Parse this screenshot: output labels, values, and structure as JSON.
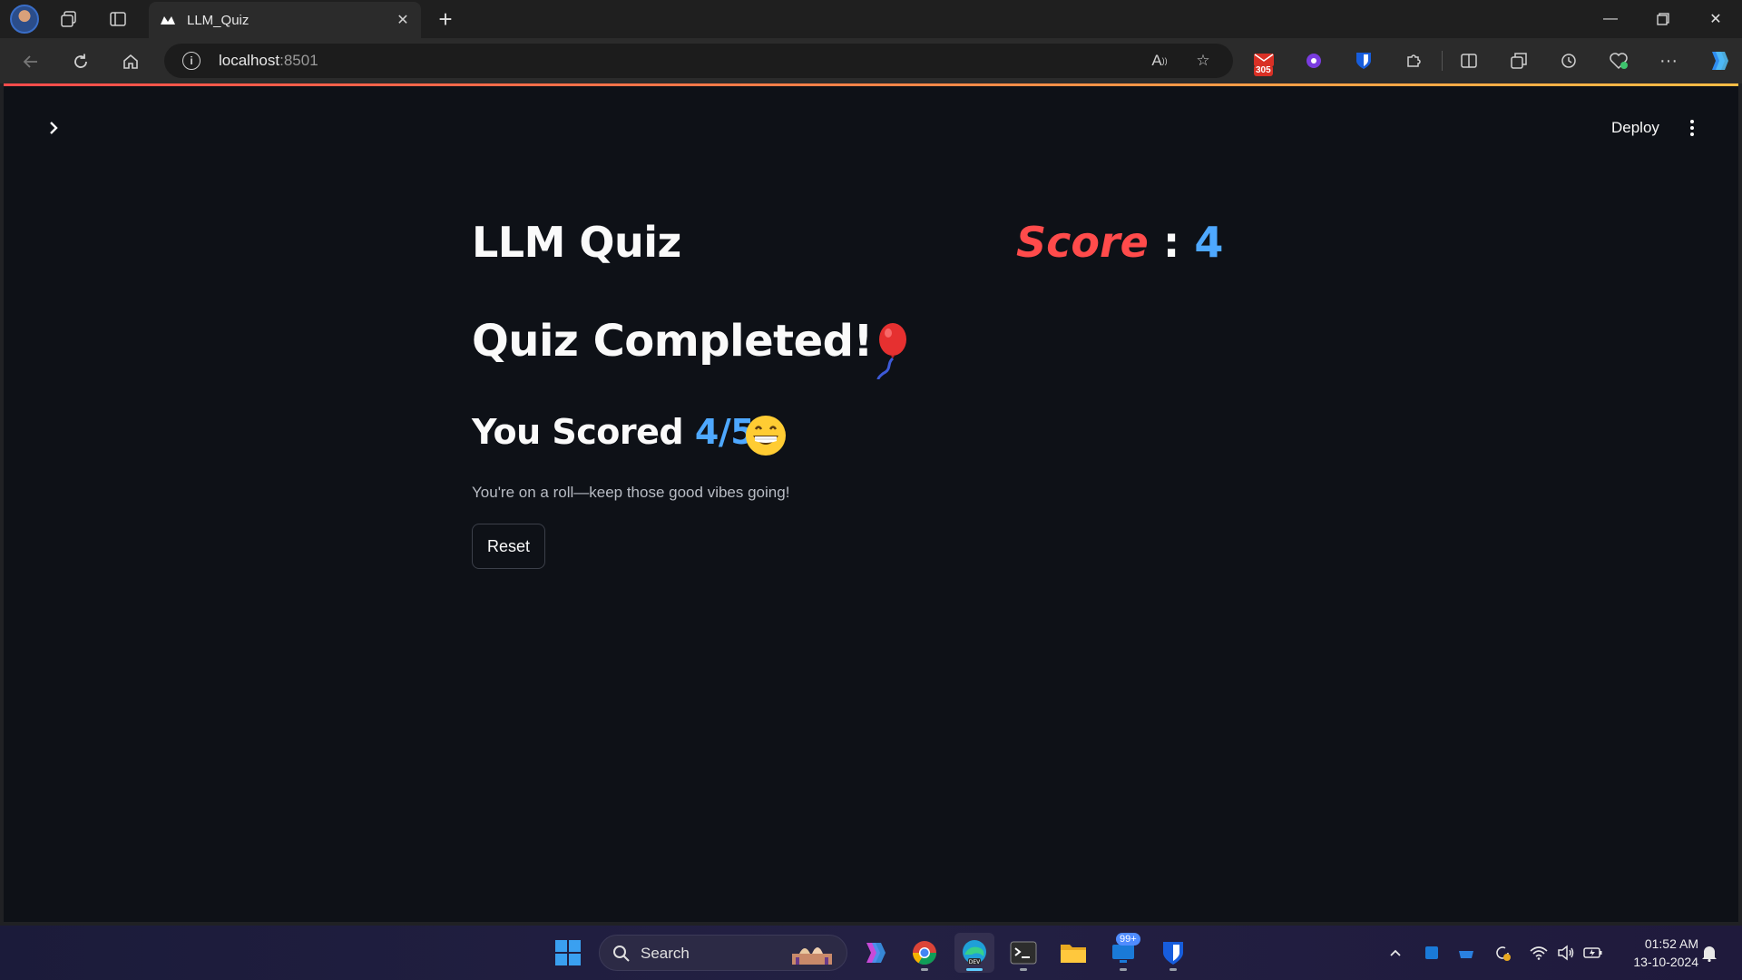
{
  "browser": {
    "tab_title": "LLM_Quiz",
    "url_host": "localhost",
    "url_port": ":8501",
    "extension_badge": "305"
  },
  "app": {
    "deploy_label": "Deploy",
    "title": "LLM Quiz",
    "score_label": "Score",
    "score_separator": ":",
    "score_value": "4",
    "completed_heading": "Quiz Completed!",
    "scored_prefix": "You Scored",
    "scored_fraction": "4/5",
    "message": "You're on a roll—keep those good vibes going!",
    "reset_label": "Reset",
    "accent_red": "#ff4b4b",
    "accent_blue": "#4ea8ff"
  },
  "taskbar": {
    "search_label": "Search",
    "notifications_badge": "99+",
    "time": "01:52 AM",
    "date": "13-10-2024"
  }
}
